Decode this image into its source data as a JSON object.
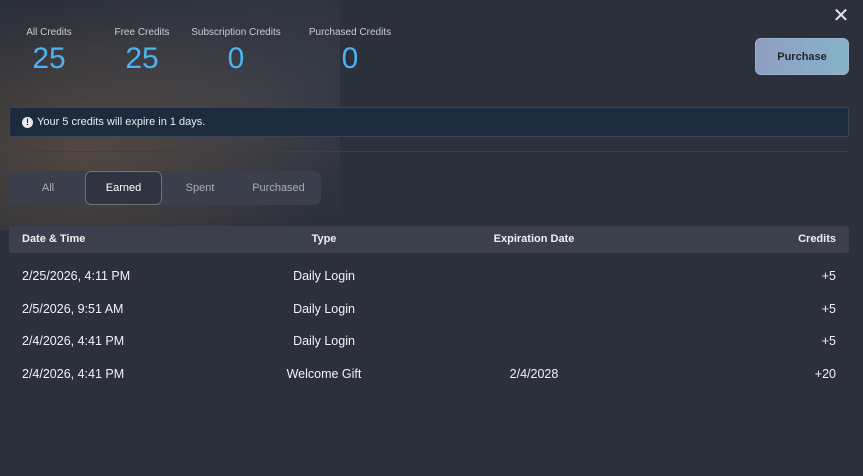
{
  "stats": [
    {
      "label": "All Credits",
      "value": "25"
    },
    {
      "label": "Free Credits",
      "value": "25"
    },
    {
      "label": "Subscription Credits",
      "value": "0"
    },
    {
      "label": "Purchased Credits",
      "value": "0"
    }
  ],
  "purchase_label": "Purchase",
  "alert_text": "Your 5 credits will expire in 1 days.",
  "tabs": [
    {
      "label": "All"
    },
    {
      "label": "Earned",
      "selected": true
    },
    {
      "label": "Spent"
    },
    {
      "label": "Purchased"
    }
  ],
  "table": {
    "headers": [
      "Date & Time",
      "Type",
      "Expiration Date",
      "Credits"
    ],
    "rows": [
      [
        "2/25/2026, 4:11 PM",
        "Daily Login",
        "",
        "+5"
      ],
      [
        "2/5/2026, 9:51 AM",
        "Daily Login",
        "",
        "+5"
      ],
      [
        "2/4/2026, 4:41 PM",
        "Daily Login",
        "",
        "+5"
      ],
      [
        "2/4/2026, 4:41 PM",
        "Welcome Gift",
        "2/4/2028",
        "+20"
      ]
    ]
  },
  "colors": {
    "background": "#2b303b",
    "accent_value": "#4db3f0",
    "alert_bg": "#1d2b3f"
  },
  "icons": {
    "close": "close-icon",
    "alert": "exclamation-circle-icon"
  }
}
